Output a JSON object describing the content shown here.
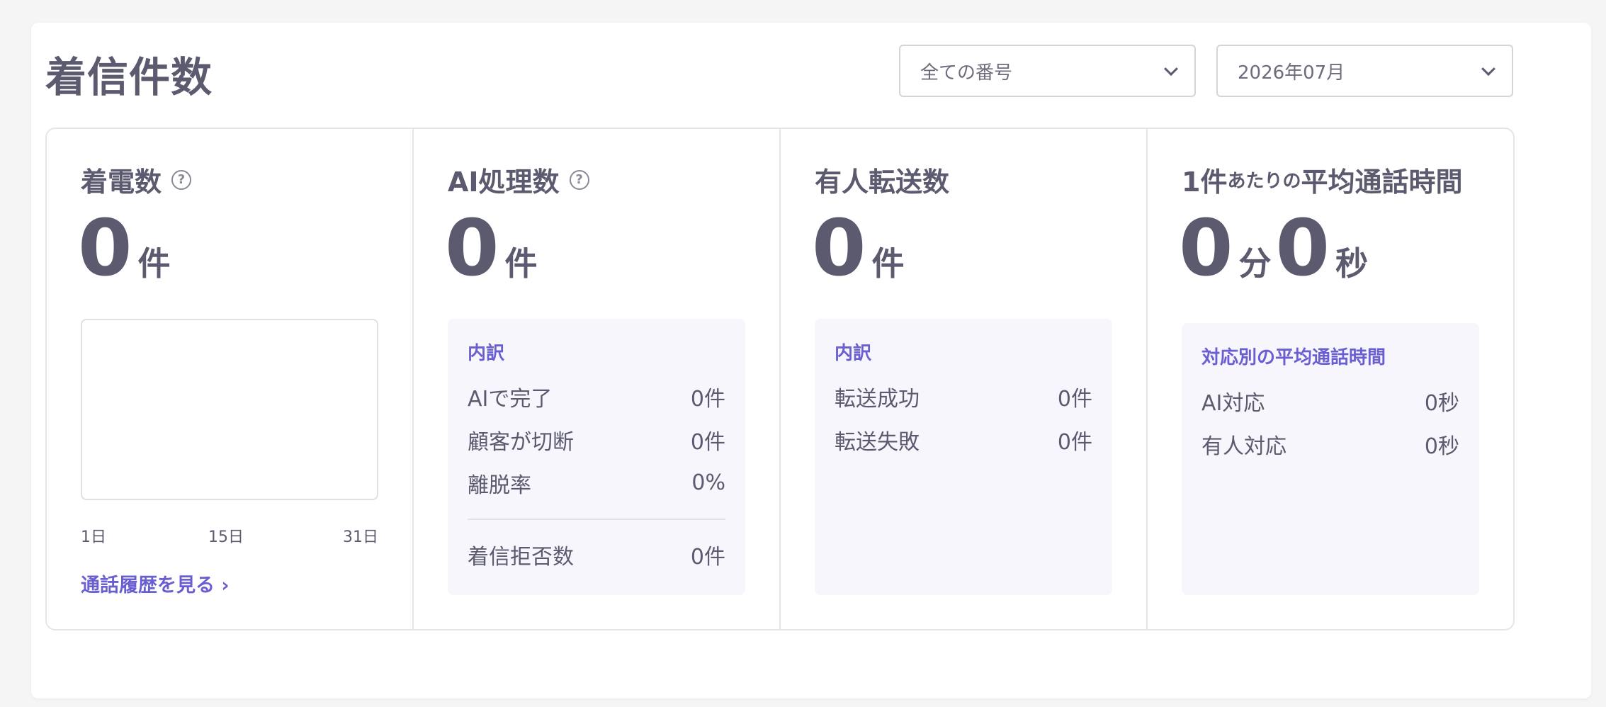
{
  "header": {
    "title": "着信件数",
    "number_select": "全ての番号",
    "month_select": "2026年07月"
  },
  "cards": {
    "calls": {
      "title": "着電数",
      "value": "0",
      "unit": "件",
      "chart_ticks": [
        "1日",
        "15日",
        "31日"
      ],
      "history_link": "通話履歴を見る ›"
    },
    "ai": {
      "title": "AI処理数",
      "value": "0",
      "unit": "件",
      "breakdown_title": "内訳",
      "rows": [
        {
          "label": "AIで完了",
          "value": "0件"
        },
        {
          "label": "顧客が切断",
          "value": "0件"
        },
        {
          "label": "離脱率",
          "value": "0%"
        }
      ],
      "reject": {
        "label": "着信拒否数",
        "value": "0件"
      }
    },
    "transfer": {
      "title": "有人転送数",
      "value": "0",
      "unit": "件",
      "breakdown_title": "内訳",
      "rows": [
        {
          "label": "転送成功",
          "value": "0件"
        },
        {
          "label": "転送失敗",
          "value": "0件"
        }
      ]
    },
    "duration": {
      "title_pre": "1件",
      "title_small": "あたりの",
      "title_post": "平均通話時間",
      "minutes": "0",
      "minutes_unit": "分",
      "seconds": "0",
      "seconds_unit": "秒",
      "breakdown_title": "対応別の平均通話時間",
      "rows": [
        {
          "label": "AI対応",
          "value": "0秒"
        },
        {
          "label": "有人対応",
          "value": "0秒"
        }
      ]
    }
  },
  "icons": {
    "help": "question-circle-icon",
    "dropdown": "chevron-down-icon"
  },
  "colors": {
    "accent": "#6a5fd0",
    "text": "#5b5a6e",
    "panel_bg": "#f7f6fd"
  }
}
